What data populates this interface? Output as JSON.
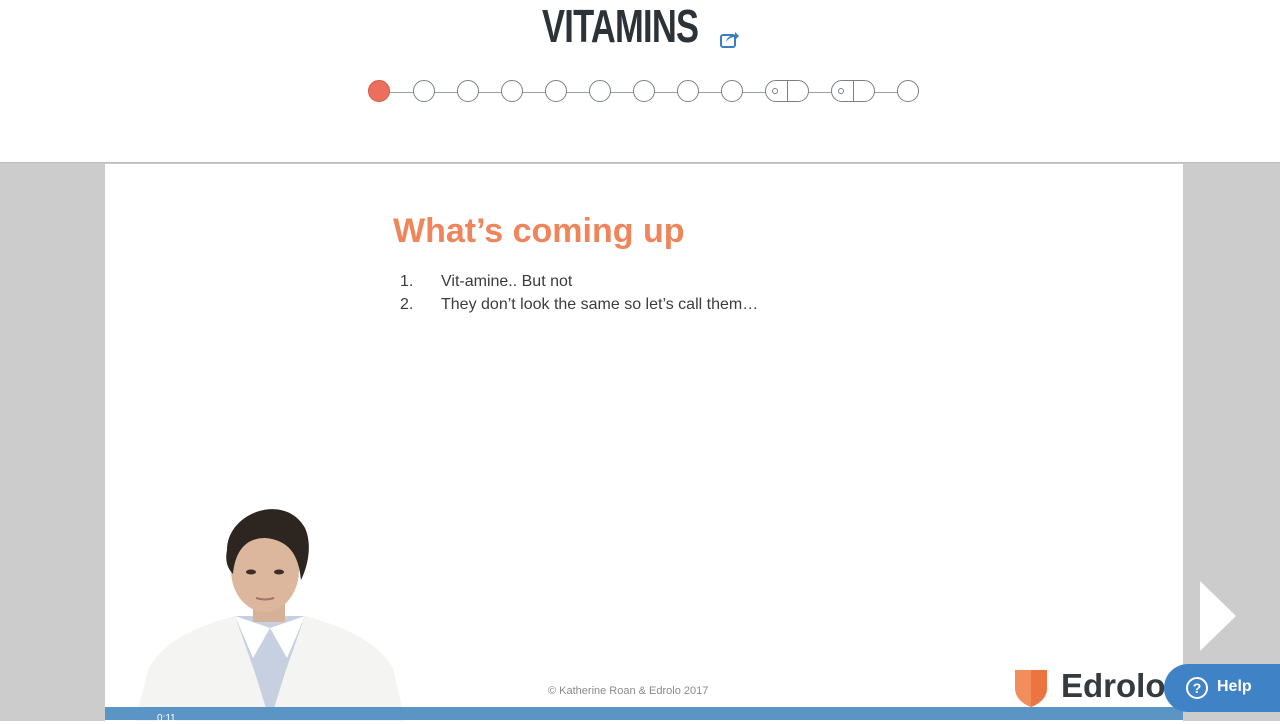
{
  "header": {
    "title": "VITAMINS",
    "share_icon": "share-icon"
  },
  "stepper": {
    "total_steps": 12,
    "current_step": 1
  },
  "slide": {
    "heading": "What’s coming up",
    "items": [
      {
        "num": "1.",
        "text": "Vit-amine.. But not"
      },
      {
        "num": "2.",
        "text": "They don’t look the same so let’s call them…"
      }
    ],
    "copyright": "© Katherine Roan & Edrolo 2017",
    "brand_name": "Edrolo"
  },
  "video_bar": {
    "time": "0:11"
  },
  "help": {
    "label": "Help",
    "icon_glyph": "?"
  },
  "colors": {
    "accent_heading": "#f0845a",
    "active_step": "#ec6f5d",
    "help_button": "#3f83c6",
    "video_bar": "#5a95c5"
  }
}
